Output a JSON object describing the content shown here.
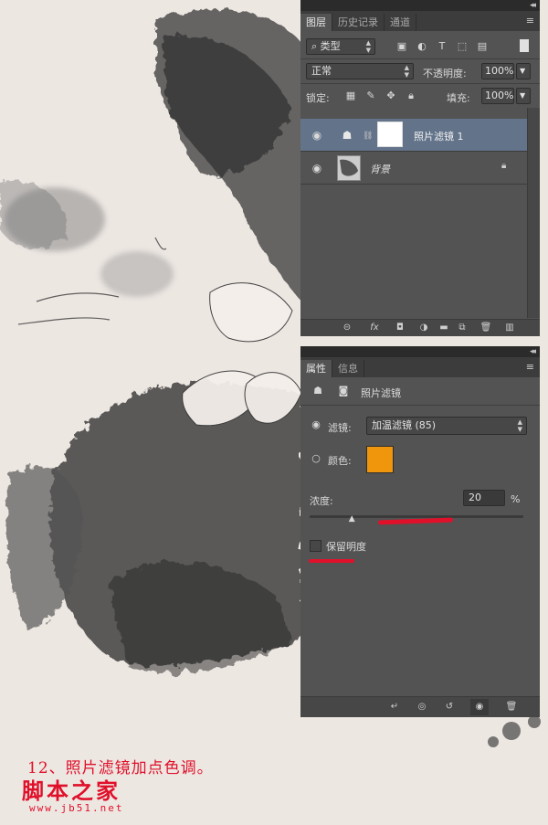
{
  "layers_panel": {
    "tabs": [
      "图层",
      "历史记录",
      "通道"
    ],
    "filter_kind": "类型",
    "blend_mode": "正常",
    "opacity_label": "不透明度:",
    "opacity_value": "100%",
    "lock_label": "锁定:",
    "fill_label": "填充:",
    "fill_value": "100%",
    "layers": [
      {
        "name": "照片滤镜 1",
        "selected": true
      },
      {
        "name": "背景",
        "locked": true
      }
    ]
  },
  "properties_panel": {
    "tabs": [
      "属性",
      "信息"
    ],
    "title": "照片滤镜",
    "filter_label": "滤镜:",
    "filter_value": "加温滤镜 (85)",
    "color_label": "颜色:",
    "color_swatch": "#f0960c",
    "density_label": "浓度:",
    "density_value": "20",
    "density_unit": "%",
    "density_fraction": 0.2,
    "preserve_luminosity_label": "保留明度"
  },
  "annotation": {
    "caption": "12、照片滤镜加点色调。",
    "watermark_title": "脚本之家",
    "watermark_url": "www.jb51.net"
  },
  "colors": {
    "panel_bg": "#535353",
    "selected_layer": "#62738a",
    "markup_red": "#e0102a"
  }
}
